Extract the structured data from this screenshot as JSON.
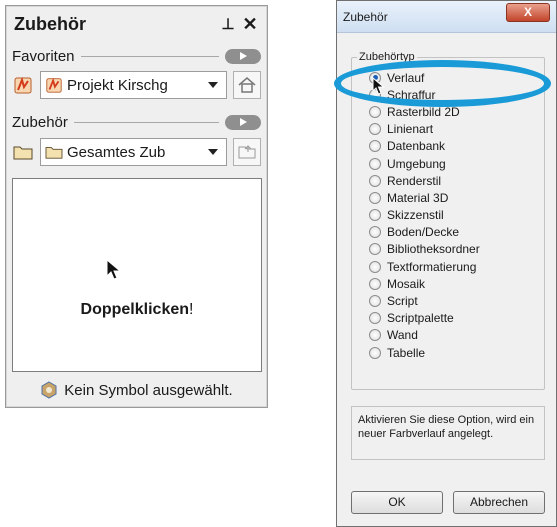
{
  "palette": {
    "title": "Zubehör",
    "favoriten_label": "Favoriten",
    "favoriten_combo": "Projekt Kirschg",
    "zubehoer_label": "Zubehör",
    "zubehoer_combo": "Gesamtes Zub",
    "preview_hint_bold": "Doppelklicken",
    "preview_hint_rest": "!",
    "status": "Kein Symbol ausgewählt."
  },
  "dialog": {
    "title": "Zubehör",
    "close": "X",
    "group_legend": "Zubehörtyp",
    "options": [
      "Verlauf",
      "Schraffur",
      "Rasterbild 2D",
      "Linienart",
      "Datenbank",
      "Umgebung",
      "Renderstil",
      "Material 3D",
      "Skizzenstil",
      "Boden/Decke",
      "Bibliotheksordner",
      "Textformatierung",
      "Mosaik",
      "Script",
      "Scriptpalette",
      "Wand",
      "Tabelle"
    ],
    "selected_option": "Verlauf",
    "hint": "Aktivieren Sie diese Option, wird ein neuer Farbverlauf angelegt.",
    "ok_label": "OK",
    "cancel_label": "Abbrechen"
  },
  "colors": {
    "highlight_ellipse": "#1a9bd7",
    "radio_selected": "#1d5fb5"
  }
}
